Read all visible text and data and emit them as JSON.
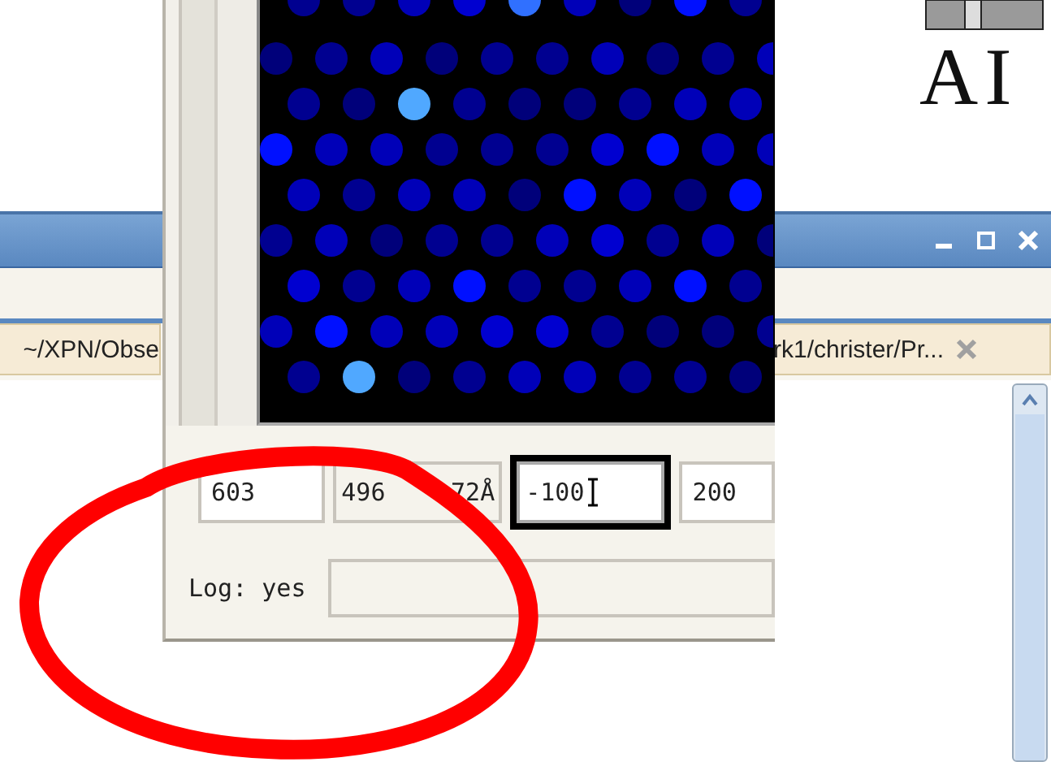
{
  "logo": {
    "text": "AI"
  },
  "back_window": {
    "tabs": [
      {
        "label": "~/XPN/Obse",
        "closable": false
      },
      {
        "label": "rk1/christer/Pr...",
        "closable": true
      }
    ]
  },
  "front_window": {
    "fields": [
      {
        "value": "603",
        "kind": "input",
        "focused": false
      },
      {
        "value": "496",
        "value_end": "72Å",
        "kind": "readonly",
        "focused": false
      },
      {
        "value": "-100",
        "kind": "input",
        "focused": true
      },
      {
        "value": "200",
        "kind": "input",
        "focused": false
      }
    ],
    "log_label": "Log: yes"
  },
  "annotation": {
    "kind": "ellipse",
    "color": "#ff0000"
  }
}
